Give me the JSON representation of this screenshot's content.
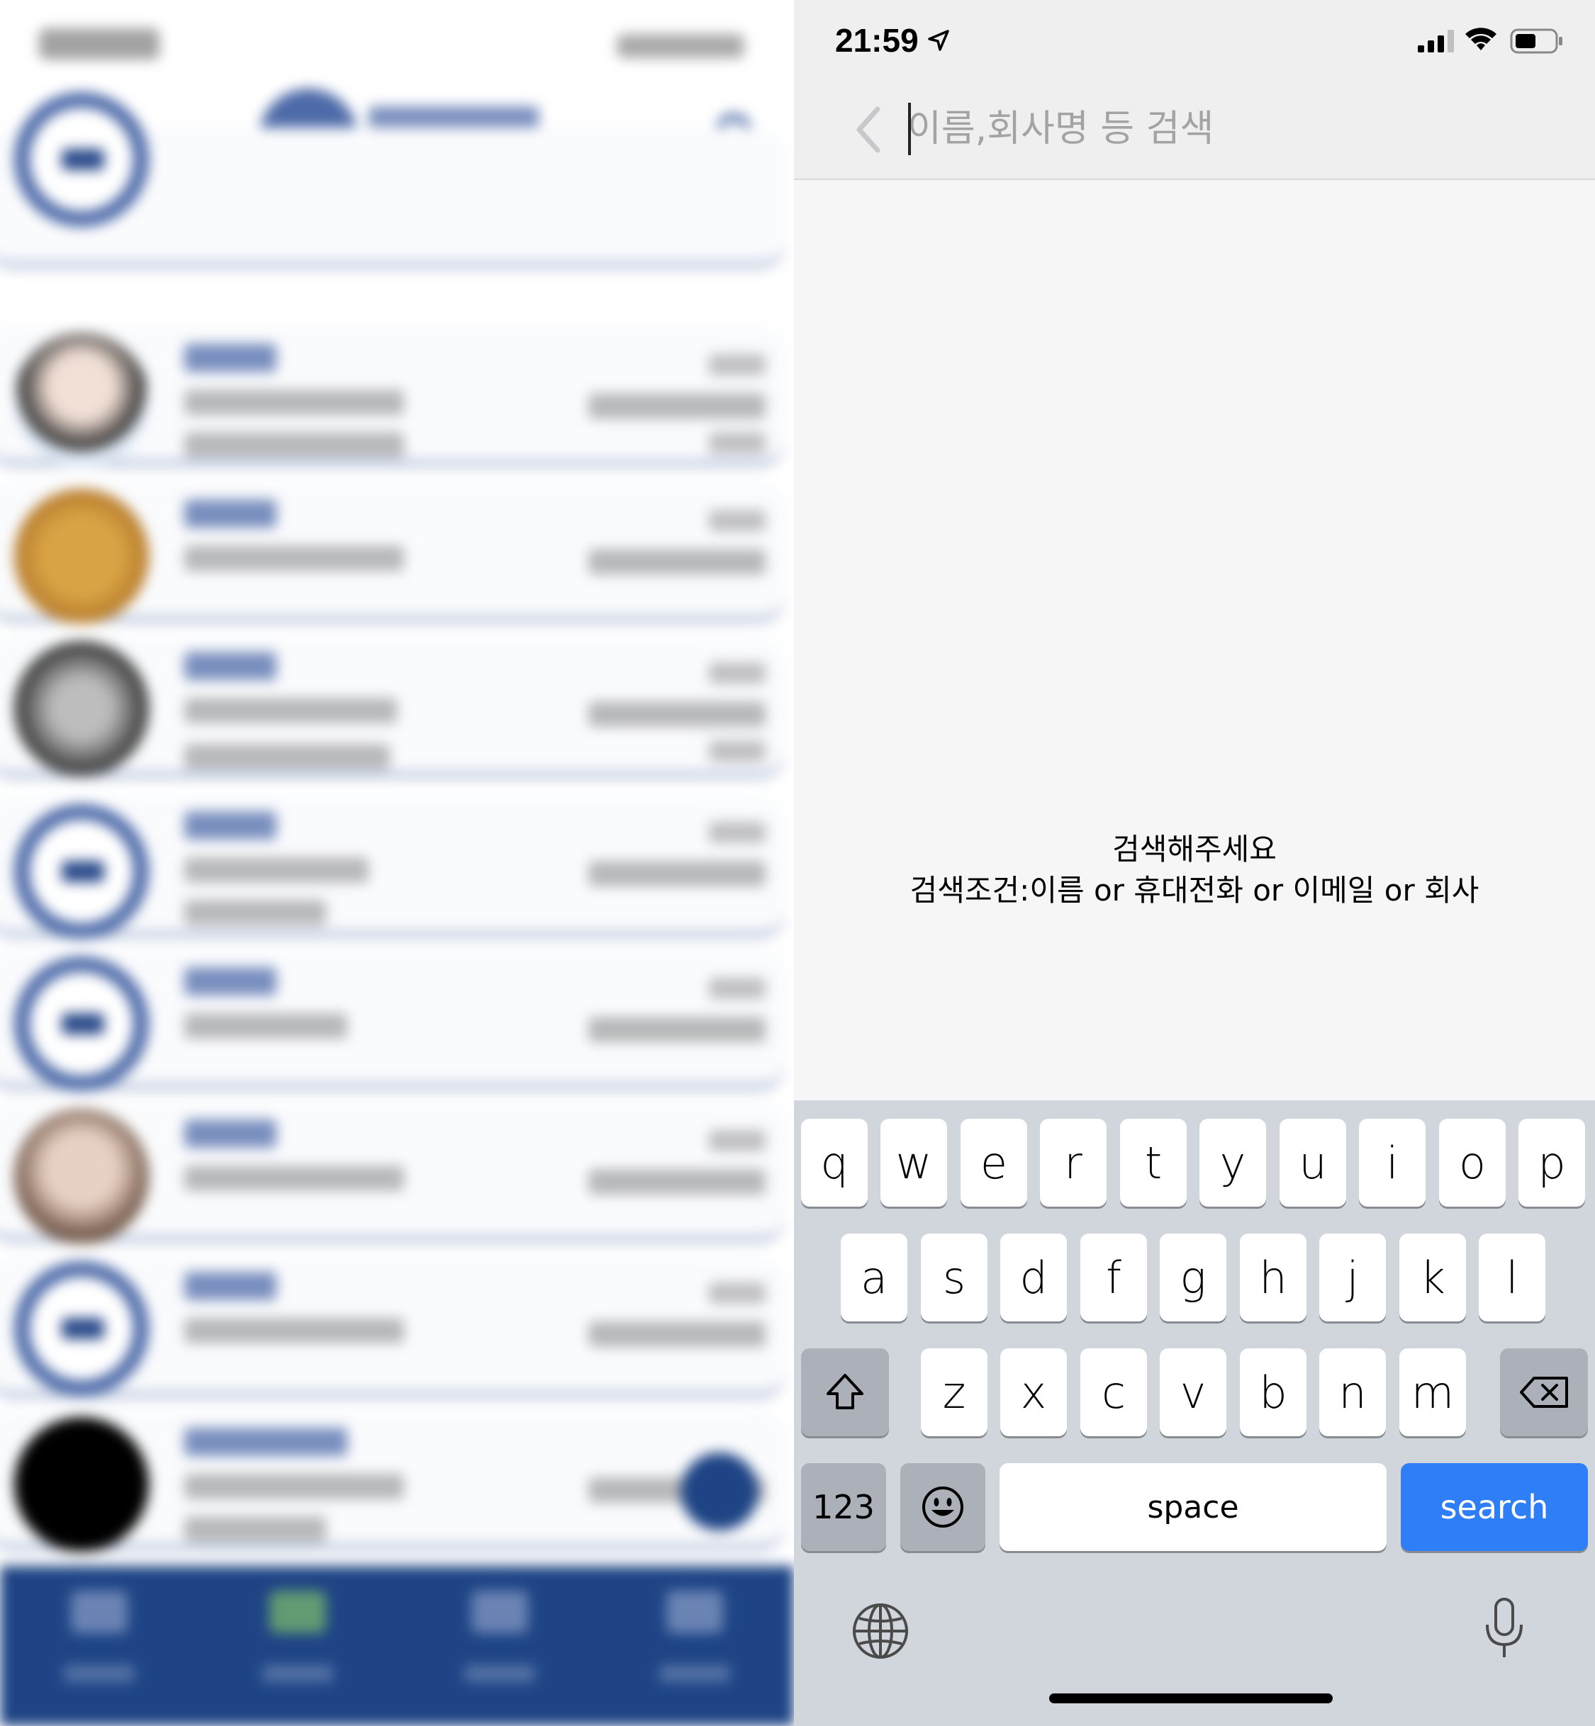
{
  "status_bar": {
    "time": "21:59",
    "icons": [
      "location-arrow-icon",
      "cellular-signal-icon",
      "wifi-icon",
      "battery-icon"
    ]
  },
  "search": {
    "placeholder": "이름,회사명 등 검색",
    "value": ""
  },
  "empty_state": {
    "title": "검색해주세요",
    "hint": "검색조건:이름 or 휴대전화 or 이메일 or 회사"
  },
  "keyboard": {
    "row1": [
      "q",
      "w",
      "e",
      "r",
      "t",
      "y",
      "u",
      "i",
      "o",
      "p"
    ],
    "row2": [
      "a",
      "s",
      "d",
      "f",
      "g",
      "h",
      "j",
      "k",
      "l"
    ],
    "row3": [
      "z",
      "x",
      "c",
      "v",
      "b",
      "n",
      "m"
    ],
    "numbers_label": "123",
    "space_label": "space",
    "action_label": "search",
    "action_color": "#2e7ef7"
  },
  "colors": {
    "accent": "#2e7ef7",
    "left_app_brand": "#1e4485"
  }
}
